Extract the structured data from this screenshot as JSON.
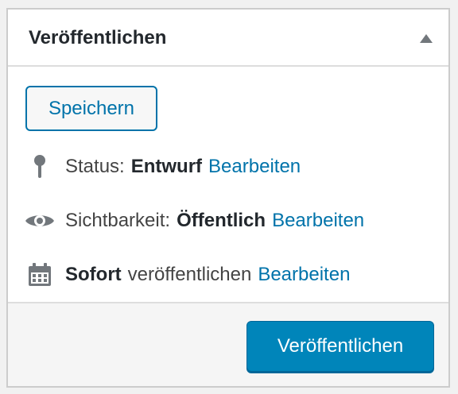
{
  "box": {
    "title": "Veröffentlichen"
  },
  "save_button": {
    "label": "Speichern"
  },
  "status": {
    "label": "Status:",
    "value": "Entwurf",
    "edit_label": "Bearbeiten",
    "icon": "pin-icon"
  },
  "visibility": {
    "label": "Sichtbarkeit:",
    "value": "Öffentlich",
    "edit_label": "Bearbeiten",
    "icon": "eye-icon"
  },
  "schedule": {
    "value": "Sofort",
    "label": "veröffentlichen",
    "edit_label": "Bearbeiten",
    "icon": "calendar-icon"
  },
  "publish_button": {
    "label": "Veröffentlichen"
  },
  "colors": {
    "accent": "#0073aa",
    "primary_button": "#0085ba",
    "icon": "#72777c"
  }
}
